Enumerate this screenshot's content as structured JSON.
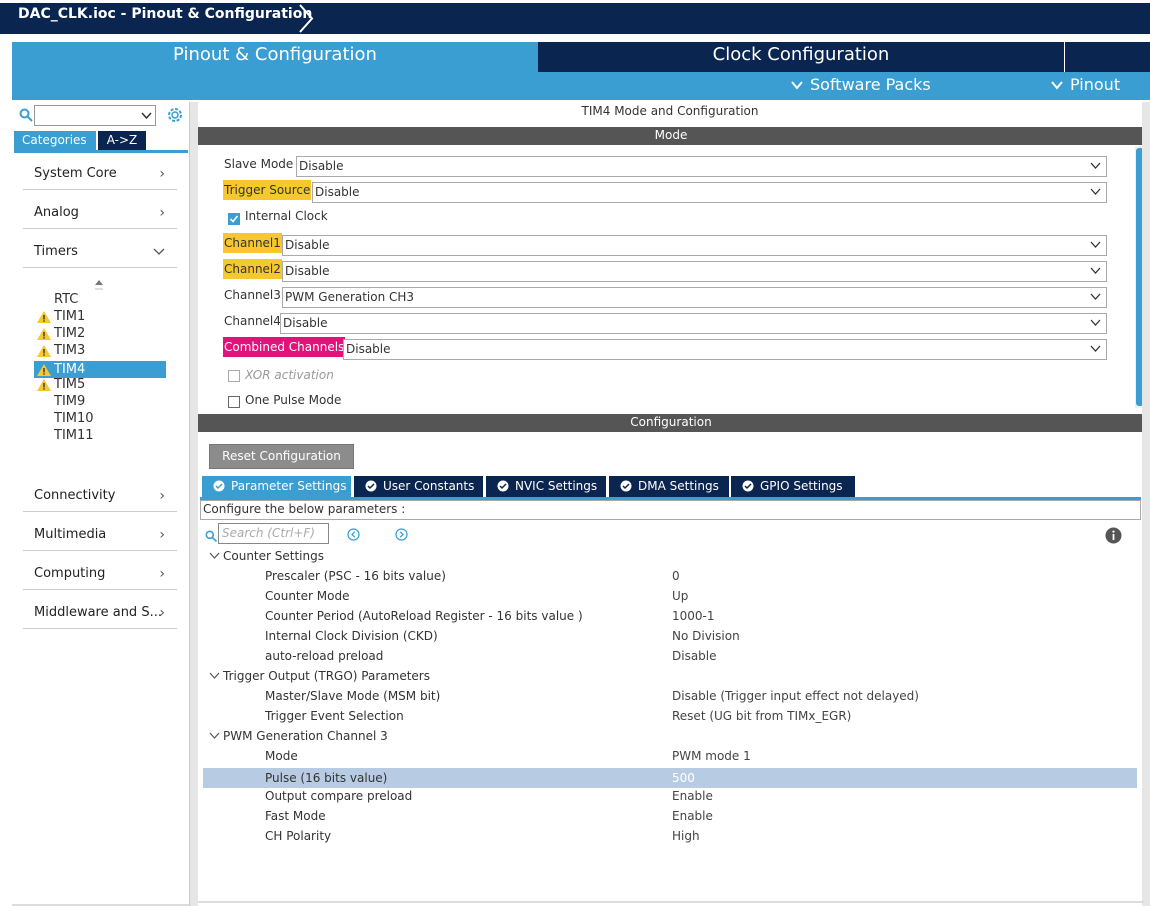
{
  "window": {
    "title": "DAC_CLK.ioc - Pinout & Configuration"
  },
  "main_tabs": {
    "pinout": "Pinout & Configuration",
    "clock": "Clock Configuration",
    "software_packs": "Software Packs",
    "pinout_menu": "Pinout"
  },
  "left": {
    "search_value": "",
    "tabs": {
      "categories": "Categories",
      "az": "A->Z"
    },
    "categories": [
      "System Core",
      "Analog",
      "Timers",
      "Connectivity",
      "Multimedia",
      "Computing",
      "Middleware and S..."
    ],
    "timers": [
      "RTC",
      "TIM1",
      "TIM2",
      "TIM3",
      "TIM4",
      "TIM5",
      "TIM9",
      "TIM10",
      "TIM11"
    ],
    "selected_timer": "TIM4"
  },
  "mode": {
    "title": "TIM4 Mode and Configuration",
    "section": "Mode",
    "slave_mode": {
      "label": "Slave Mode",
      "value": "Disable"
    },
    "trigger_source": {
      "label": "Trigger Source",
      "value": "Disable"
    },
    "internal_clock": {
      "label": "Internal Clock",
      "checked": true
    },
    "channel1": {
      "label": "Channel1",
      "value": "Disable"
    },
    "channel2": {
      "label": "Channel2",
      "value": "Disable"
    },
    "channel3": {
      "label": "Channel3",
      "value": "PWM Generation CH3"
    },
    "channel4": {
      "label": "Channel4",
      "value": "Disable"
    },
    "combined_channels": {
      "label": "Combined Channels",
      "value": "Disable"
    },
    "xor_activation": {
      "label": "XOR activation",
      "checked": false
    },
    "one_pulse_mode": {
      "label": "One Pulse Mode",
      "checked": false
    }
  },
  "config": {
    "section": "Configuration",
    "reset_button": "Reset Configuration",
    "tabs": [
      "Parameter Settings",
      "User Constants",
      "NVIC Settings",
      "DMA Settings",
      "GPIO Settings"
    ],
    "active_tab": "Parameter Settings",
    "description": "Configure the below parameters :",
    "search_placeholder": "Search (Ctrl+F)",
    "groups": [
      {
        "name": "Counter Settings",
        "params": [
          {
            "name": "Prescaler (PSC - 16 bits value)",
            "value": "0"
          },
          {
            "name": "Counter Mode",
            "value": "Up"
          },
          {
            "name": "Counter Period (AutoReload Register - 16 bits value )",
            "value": "1000-1"
          },
          {
            "name": "Internal Clock Division (CKD)",
            "value": "No Division"
          },
          {
            "name": "auto-reload preload",
            "value": "Disable"
          }
        ]
      },
      {
        "name": "Trigger Output (TRGO) Parameters",
        "params": [
          {
            "name": "Master/Slave Mode (MSM bit)",
            "value": "Disable (Trigger input effect not delayed)"
          },
          {
            "name": "Trigger Event Selection",
            "value": "Reset (UG bit from TIMx_EGR)"
          }
        ]
      },
      {
        "name": "PWM Generation Channel 3",
        "params": [
          {
            "name": "Mode",
            "value": "PWM mode 1"
          },
          {
            "name": "Pulse (16 bits value)",
            "value": "500"
          },
          {
            "name": "Output compare preload",
            "value": "Enable"
          },
          {
            "name": "Fast Mode",
            "value": "Enable"
          },
          {
            "name": "CH Polarity",
            "value": "High"
          }
        ]
      }
    ]
  },
  "colors": {
    "navy": "#0b2551",
    "accent_blue": "#3a9ed3",
    "highlight_yellow": "#f6c82e",
    "highlight_pink": "#e3117a",
    "section_grey": "#555555",
    "selected_row": "#b7cce2"
  }
}
